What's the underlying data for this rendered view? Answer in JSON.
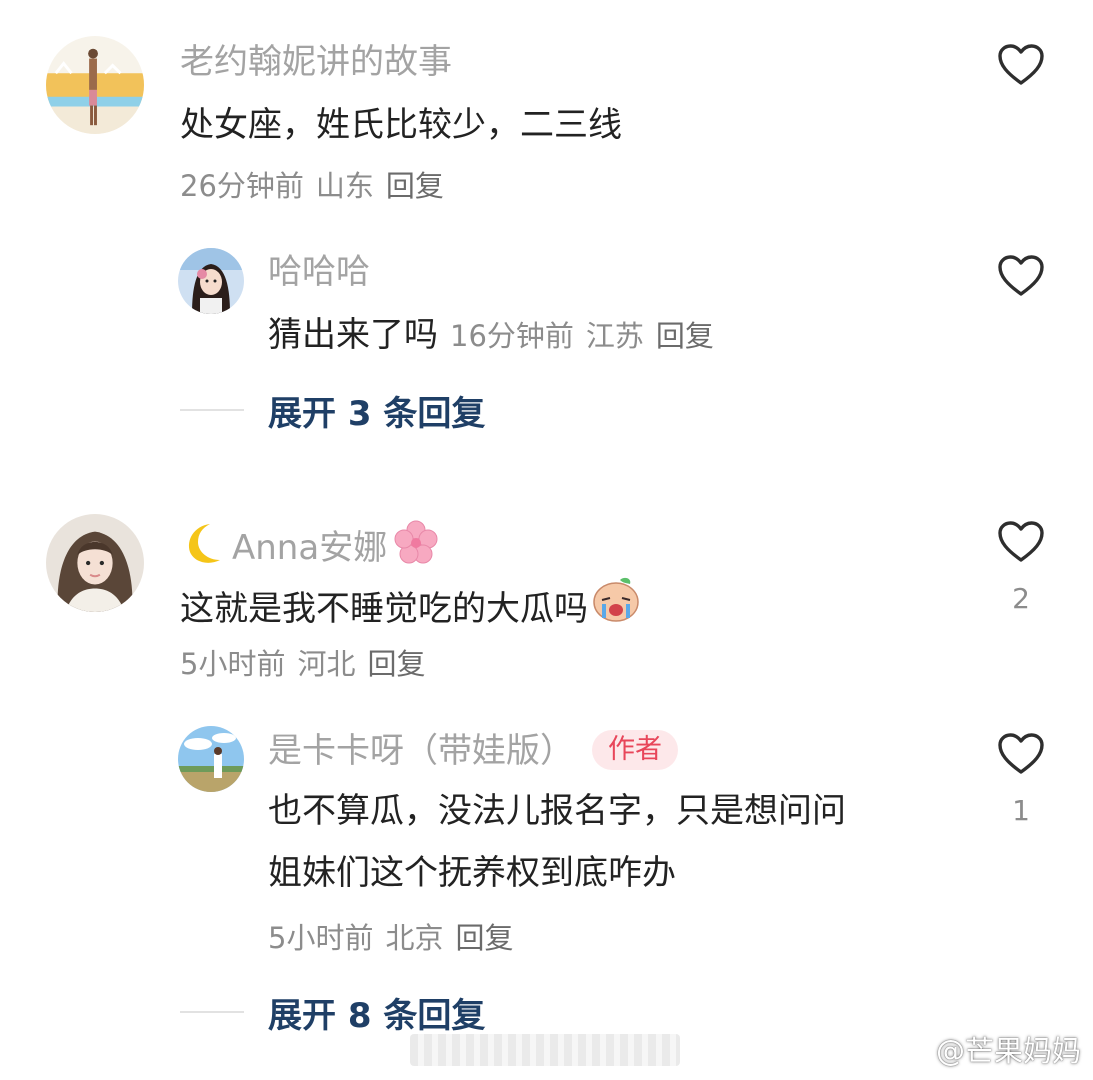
{
  "comments": [
    {
      "username": "老约翰妮讲的故事",
      "text": "处女座，姓氏比较少，二三线",
      "time": "26分钟前",
      "location": "山东",
      "reply_label": "回复",
      "likes": ""
    },
    {
      "username": "哈哈哈",
      "text": "猜出来了吗",
      "time": "16分钟前",
      "location": "江苏",
      "reply_label": "回复",
      "likes": ""
    },
    {
      "username_prefix_icon": "crescent-moon-emoji",
      "username": "Anna安娜",
      "username_suffix_icon": "cherry-blossom-emoji",
      "text": "这就是我不睡觉吃的大瓜吗",
      "text_suffix_icon": "crying-face-emoji",
      "time": "5小时前",
      "location": "河北",
      "reply_label": "回复",
      "likes": "2"
    },
    {
      "username": "是卡卡呀（带娃版）",
      "badge": "作者",
      "text_line1": "也不算瓜，没法儿报名字，只是想问问",
      "text_line2": "姐妹们这个抚养权到底咋办",
      "time": "5小时前",
      "location": "北京",
      "reply_label": "回复",
      "likes": "1"
    }
  ],
  "expand_replies": [
    {
      "label": "展开 3 条回复"
    },
    {
      "label": "展开 8 条回复"
    }
  ],
  "watermark": {
    "text": "@芒果妈妈",
    "icon": "weibo-logo-icon"
  },
  "colors": {
    "username": "#a3a3a3",
    "text": "#222222",
    "meta": "#8c8c8c",
    "expand": "#1f3f66",
    "badge_bg": "#fde8ea",
    "badge_text": "#e8465a"
  }
}
